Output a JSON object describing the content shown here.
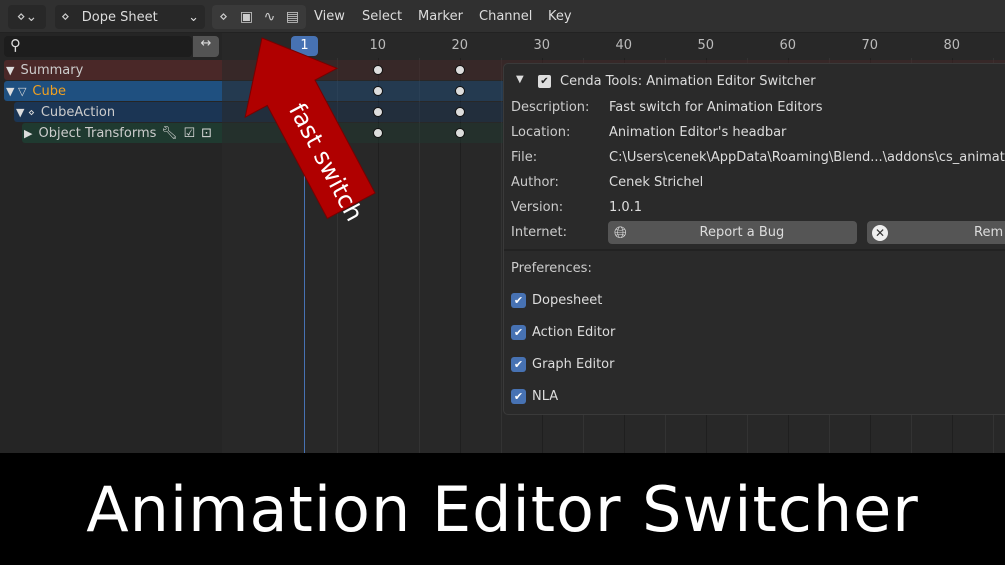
{
  "header": {
    "editor_name": "Dope Sheet",
    "menus": [
      "View",
      "Select",
      "Marker",
      "Channel",
      "Key"
    ]
  },
  "timeline": {
    "current_frame": "1",
    "ticks": [
      "10",
      "20",
      "30",
      "40",
      "50",
      "60",
      "70",
      "80"
    ]
  },
  "channels": [
    {
      "label": "Summary",
      "color": "#4a2828"
    },
    {
      "label": "Cube",
      "color": "#1f5080"
    },
    {
      "label": "CubeAction",
      "color": "#1b3554"
    },
    {
      "label": "Object Transforms",
      "color": "#1f3a30"
    }
  ],
  "keyframes": [
    10,
    20
  ],
  "arrow": {
    "text": "fast switch",
    "color": "#b00000"
  },
  "addon": {
    "title": "Cenda Tools: Animation Editor Switcher",
    "rows": [
      {
        "label": "Description:",
        "value": "Fast switch for Animation Editors"
      },
      {
        "label": "Location:",
        "value": "Animation Editor's headbar"
      },
      {
        "label": "File:",
        "value": "C:\\Users\\cenek\\AppData\\Roaming\\Blend...\\addons\\cs_animation_"
      },
      {
        "label": "Author:",
        "value": "Cenek Strichel"
      },
      {
        "label": "Version:",
        "value": "1.0.1"
      }
    ],
    "internet_label": "Internet:",
    "report_bug": "Report a Bug",
    "remove": "Rem",
    "preferences_label": "Preferences:",
    "preferences": [
      "Dopesheet",
      "Action Editor",
      "Graph Editor",
      "NLA"
    ]
  },
  "banner": "Animation Editor Switcher"
}
